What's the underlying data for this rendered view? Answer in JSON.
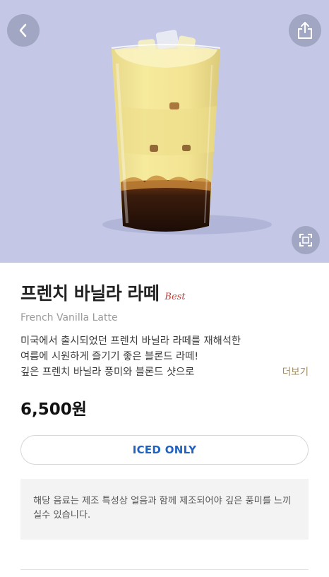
{
  "header": {
    "back_icon": "chevron-left-icon",
    "share_icon": "share-icon",
    "expand_icon": "expand-icon"
  },
  "product": {
    "name_ko": "프렌치 바닐라 라떼",
    "badge": "Best",
    "name_en": "French Vanilla Latte",
    "description": [
      "미국에서 출시되었던 프렌치 바닐라 라떼를 재해석한",
      "여름에 시원하게 즐기기 좋은 블론드 라떼!",
      "깊은 프렌치 바닐라 풍미와 블론드 샷으로"
    ],
    "more_label": "더보기",
    "price": "6,500원",
    "temperature_label": "ICED ONLY",
    "notice": "해당 음료는 제조 특성상 얼음과 함께 제조되어야 깊은 풍미를 느끼실수 있습니다."
  },
  "colors": {
    "hero_background": "#c4c8e6",
    "badge": "#c0413b",
    "accent_blue": "#1f62c1",
    "more_link": "#a0895e"
  }
}
